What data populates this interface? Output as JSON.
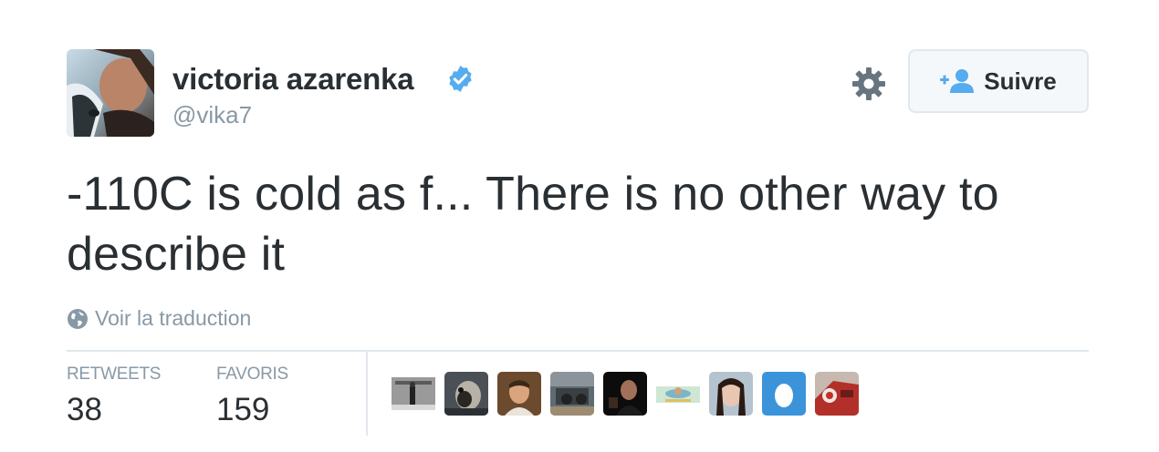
{
  "user": {
    "full_name": "victoria azarenka",
    "handle": "@vika7",
    "verified": true,
    "verified_icon": "verified-badge-icon",
    "avatar_icon": "profile-avatar"
  },
  "actions": {
    "settings_icon": "gear-icon",
    "follow_label": "Suivre",
    "follow_icon": "add-user-icon"
  },
  "tweet": {
    "text": "-110C is cold as f... There is no other way to describe it",
    "translate_label": "Voir la traduction",
    "translate_icon": "globe-icon"
  },
  "stats": {
    "retweets_label": "RETWEETS",
    "retweets_count": "38",
    "favorites_label": "FAVORIS",
    "favorites_count": "159"
  },
  "favoriters": [
    "favoriter-avatar-1",
    "favoriter-avatar-2",
    "favoriter-avatar-3",
    "favoriter-avatar-4",
    "favoriter-avatar-5",
    "favoriter-avatar-6",
    "favoriter-avatar-7",
    "favoriter-avatar-egg",
    "favoriter-avatar-9"
  ],
  "colors": {
    "text": "#292f33",
    "muted": "#8899a6",
    "verified_blue": "#55acee",
    "border": "#e1e8ed",
    "button_bg": "#f5f8fa",
    "egg_blue": "#3b94d9"
  }
}
